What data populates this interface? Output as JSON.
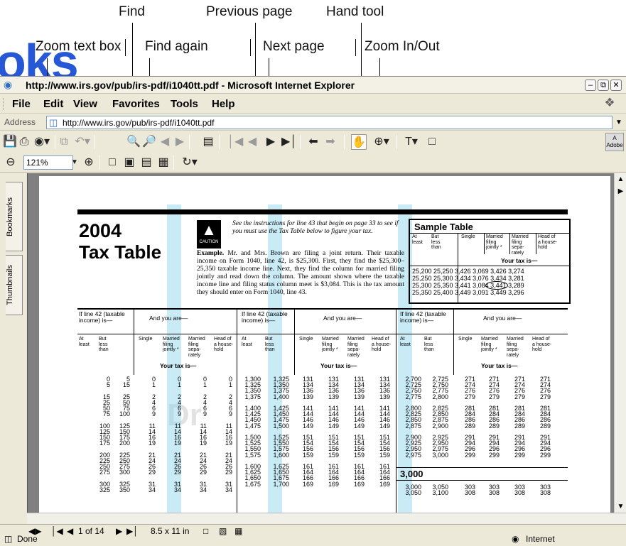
{
  "callouts": {
    "find": "Find",
    "previous_page": "Previous page",
    "hand_tool": "Hand tool",
    "zoom_text_box": "Zoom text box",
    "find_again": "Find again",
    "next_page": "Next page",
    "zoom_in_out": "Zoom In/Out"
  },
  "watermark_text": "oks",
  "window": {
    "title": "http://www.irs.gov/pub/irs-pdf/i1040tt.pdf - Microsoft Internet Explorer"
  },
  "menu": {
    "file": "File",
    "edit": "Edit",
    "view": "View",
    "favorites": "Favorites",
    "tools": "Tools",
    "help": "Help"
  },
  "address": {
    "label": "Address",
    "url": "http://www.irs.gov/pub/irs-pdf/i1040tt.pdf"
  },
  "toolbar": {
    "zoom_value": "121%"
  },
  "sidebar": {
    "bookmarks": "Bookmarks",
    "thumbnails": "Thumbnails"
  },
  "navbar": {
    "page_of": "1 of 14",
    "page_size": "8.5 x 11 in"
  },
  "status": {
    "left": "Done",
    "zone": "Internet"
  },
  "doc": {
    "year": "2004",
    "title": "Tax Table",
    "caution": "CAUTION",
    "instructions": "See the instructions for line 43 that begin on page 33 to see if you must use the Tax Table below to figure your tax.",
    "example_label": "Example.",
    "example_text": "Mr. and Mrs. Brown are filing a joint return. Their taxable income on Form 1040, line 42, is $25,300. First, they find the $25,300–25,350 taxable income line. Next, they find the column for married filing jointly and read down the column. The amount shown where the taxable income line and filing status column meet is $3,084. This is the tax amount they should enter on Form 1040, line 43.",
    "sample": {
      "title": "Sample Table",
      "at_least": "At least",
      "but_less": "But less than",
      "single": "Single",
      "mfj": "Married filing jointly *",
      "mfs": "Married filing sepa-rately",
      "hoh": "Head of a house-hold",
      "your_tax": "Your tax is—",
      "rows": [
        "25,200  25,250  3,426   3,069  3,426  3,274",
        "25,250  25,300  3,434   3,076  3,434  3,281",
        "25,300  25,350  3,441   3,084  3,441  3,289",
        "25,350  25,400  3,449   3,091  3,449  3,296"
      ]
    },
    "col_if": "If line 42 (taxable income) is—",
    "col_and": "And you are—",
    "at_least": "At least",
    "but_less": "But less than",
    "single": "Single",
    "mfj": "Married filing jointly *",
    "mfs": "Married filing sepa-rately",
    "hoh": "Head of a house-hold",
    "your_tax": "Your tax is—",
    "section_3000": "3,000",
    "block1_left": "0\n5\n\n15\n25\n50\n75\n\n100\n125\n150\n175\n\n200\n225\n250\n275\n\n300\n325",
    "block1_mid": "5\n15\n\n25\n50\n75\n100\n\n125\n150\n175\n200\n\n225\n250\n275\n300\n\n325\n350",
    "block1_tax": "0\n1\n\n2\n4\n6\n9\n\n11\n14\n16\n19\n\n21\n24\n26\n29\n\n31\n34",
    "block2_left": "1,300\n1,325\n1,350\n1,375\n\n1,400\n1,425\n1,450\n1,475\n\n1,500\n1,525\n1,550\n1,575\n\n1,600\n1,625\n1,650\n1,675",
    "block2_mid": "1,325\n1,350\n1,375\n1,400\n\n1,425\n1,450\n1,475\n1,500\n\n1,525\n1,550\n1,575\n1,600\n\n1,625\n1,650\n1,675\n1,700",
    "block2_tax": "131\n134\n136\n139\n\n141\n144\n146\n149\n\n151\n154\n156\n159\n\n161\n164\n166\n169",
    "block3_left": "2,700\n2,725\n2,750\n2,775\n\n2,800\n2,825\n2,850\n2,875\n\n2,900\n2,925\n2,950\n2,975",
    "block3_mid": "2,725\n2,750\n2,775\n2,800\n\n2,825\n2,850\n2,875\n2,900\n\n2,925\n2,950\n2,975\n3,000",
    "block3_tax": "271\n274\n276\n279\n\n281\n284\n286\n289\n\n291\n294\n296\n299",
    "block4_left": "3,000\n3,050",
    "block4_mid": "3,050\n3,100",
    "block4_tax": "303\n308"
  }
}
